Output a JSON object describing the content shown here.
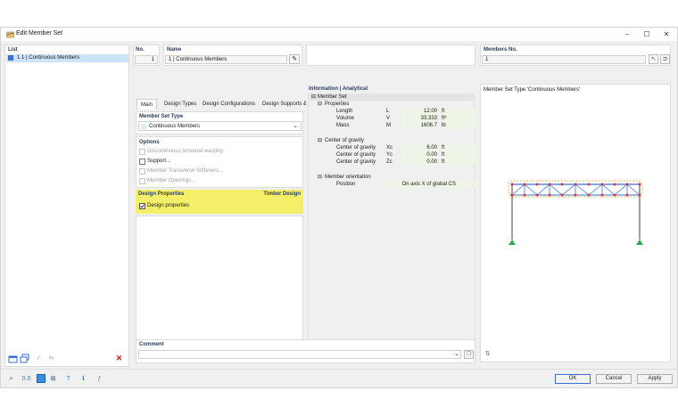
{
  "window": {
    "title": "Edit Member Set",
    "minimize": "–",
    "maximize": "☐",
    "close": "✕"
  },
  "list": {
    "label": "List",
    "items": [
      {
        "label": "1  1 | Continuous Members",
        "color": "#3a6fd8"
      }
    ]
  },
  "header": {
    "no_label": "No.",
    "no_value": "1",
    "name_label": "Name",
    "name_value": "1 | Continuous Members",
    "members_label": "Members No.",
    "members_value": "1"
  },
  "tabs": [
    {
      "label": "Main"
    },
    {
      "label": "Design Types"
    },
    {
      "label": "Design Configurations"
    },
    {
      "label": "Design Supports & Deflection"
    }
  ],
  "member_set_type": {
    "label": "Member Set Type",
    "value": "Continuous Members"
  },
  "options": {
    "label": "Options",
    "items": [
      {
        "label": "Discontinuous torsional warping",
        "checked": false,
        "disabled": true
      },
      {
        "label": "Support...",
        "checked": false,
        "disabled": false
      },
      {
        "label": "Member Transverse Stiffeners...",
        "checked": false,
        "disabled": true
      },
      {
        "label": "Member Openings...",
        "checked": false,
        "disabled": true
      }
    ]
  },
  "design_properties": {
    "label": "Design Properties",
    "right_label": "Timber Design",
    "checkbox_label": "Design properties",
    "checked": true,
    "highlight": "#f3ef68"
  },
  "info": {
    "title": "Information | Analytical",
    "root": "Member Set",
    "properties_label": "Properties",
    "properties": [
      {
        "name": "Length",
        "symbol": "L",
        "value": "12.00",
        "unit": "ft"
      },
      {
        "name": "Volume",
        "symbol": "V",
        "value": "33.333",
        "unit": "ft³"
      },
      {
        "name": "Mass",
        "symbol": "M",
        "value": "1606.7",
        "unit": "lb"
      }
    ],
    "cog_label": "Center of gravity",
    "cog": [
      {
        "name": "Center of gravity",
        "symbol": "Xc",
        "value": "6.00",
        "unit": "ft"
      },
      {
        "name": "Center of gravity",
        "symbol": "Yc",
        "value": "0.00",
        "unit": "ft"
      },
      {
        "name": "Center of gravity",
        "symbol": "Zc",
        "value": "0.00",
        "unit": "ft"
      }
    ],
    "orient_label": "Member orientation",
    "orient": {
      "name": "Position",
      "value": "On axis X of global CS"
    }
  },
  "preview": {
    "title": "Member Set Type 'Continuous Members'"
  },
  "comment": {
    "label": "Comment",
    "value": ""
  },
  "buttons": {
    "ok": "OK",
    "cancel": "Cancel",
    "apply": "Apply"
  }
}
